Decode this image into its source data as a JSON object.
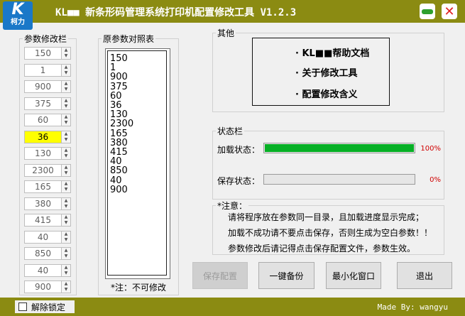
{
  "window": {
    "logo_letters": "K",
    "logo_text": "柯力",
    "title": "KL■■ 新条形码管理系统打印机配置修改工具 V1.2.3"
  },
  "param_panel": {
    "legend": "参数修改栏",
    "values": [
      "150",
      "1",
      "900",
      "375",
      "60",
      "36",
      "130",
      "2300",
      "165",
      "380",
      "415",
      "40",
      "850",
      "40",
      "900"
    ],
    "active_index": 5
  },
  "original_panel": {
    "legend": "原参数对照表",
    "values": [
      "150",
      "1",
      "900",
      "375",
      "60",
      "36",
      "130",
      "2300",
      "165",
      "380",
      "415",
      "40",
      "850",
      "40",
      "900"
    ],
    "note": "*注：不可修改"
  },
  "other_panel": {
    "legend": "其他",
    "links": [
      "· KL■■帮助文档",
      "· 关于修改工具",
      "· 配置修改含义"
    ]
  },
  "status_panel": {
    "legend": "状态栏",
    "load_label": "加载状态：",
    "load_progress": 100,
    "load_pct_text": "100%",
    "save_label": "保存状态：",
    "save_progress": 0,
    "save_pct_text": "0%"
  },
  "notes_panel": {
    "legend": "*注意：",
    "lines": [
      "请将程序放在参数同一目录，且加载进度显示完成；",
      "加载不成功请不要点击保存，否则生成为空白参数！！",
      "参数修改后请记得点击保存配置文件，参数生效。"
    ]
  },
  "buttons": {
    "save": "保存配置",
    "backup": "一键备份",
    "minimize": "最小化窗口",
    "exit": "退出"
  },
  "footer": {
    "unlock_label": "解除锁定",
    "made_by": "Made By: wangyu"
  },
  "colors": {
    "titlebar": "#8b8b12",
    "progress": "#06b025",
    "active_field": "#ffff00",
    "percent_text": "#d00000"
  }
}
